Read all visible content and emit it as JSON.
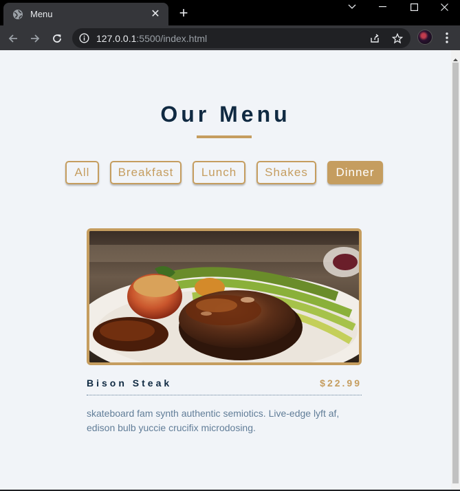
{
  "browser": {
    "tab_title": "Menu",
    "tab_close": "✕",
    "new_tab": "+",
    "url_host": "127.0.0.1",
    "url_rest": ":5500/index.html",
    "window_controls": {
      "tab_search": "⌄",
      "minimize": "—",
      "maximize": "☐",
      "close": "✕"
    }
  },
  "page": {
    "title": "Our Menu",
    "filters": [
      {
        "label": "All",
        "active": false
      },
      {
        "label": "Breakfast",
        "active": false
      },
      {
        "label": "Lunch",
        "active": false
      },
      {
        "label": "Shakes",
        "active": false
      },
      {
        "label": "Dinner",
        "active": true
      }
    ],
    "items": [
      {
        "name": "Bison Steak",
        "price": "$22.99",
        "description": "skateboard fam synth authentic semiotics. Live-edge lyft af, edison bulb yuccie crucifix microdosing."
      }
    ]
  },
  "colors": {
    "accent": "#c59d5f",
    "heading": "#102a42",
    "body_text": "#617d98",
    "page_bg": "#f1f4f8"
  },
  "icons": [
    "globe-icon",
    "close-icon",
    "plus-icon",
    "back-icon",
    "forward-icon",
    "reload-icon",
    "info-icon",
    "share-icon",
    "star-icon",
    "profile-avatar",
    "more-vert-icon",
    "chevron-down-icon",
    "minimize-icon",
    "maximize-icon"
  ]
}
